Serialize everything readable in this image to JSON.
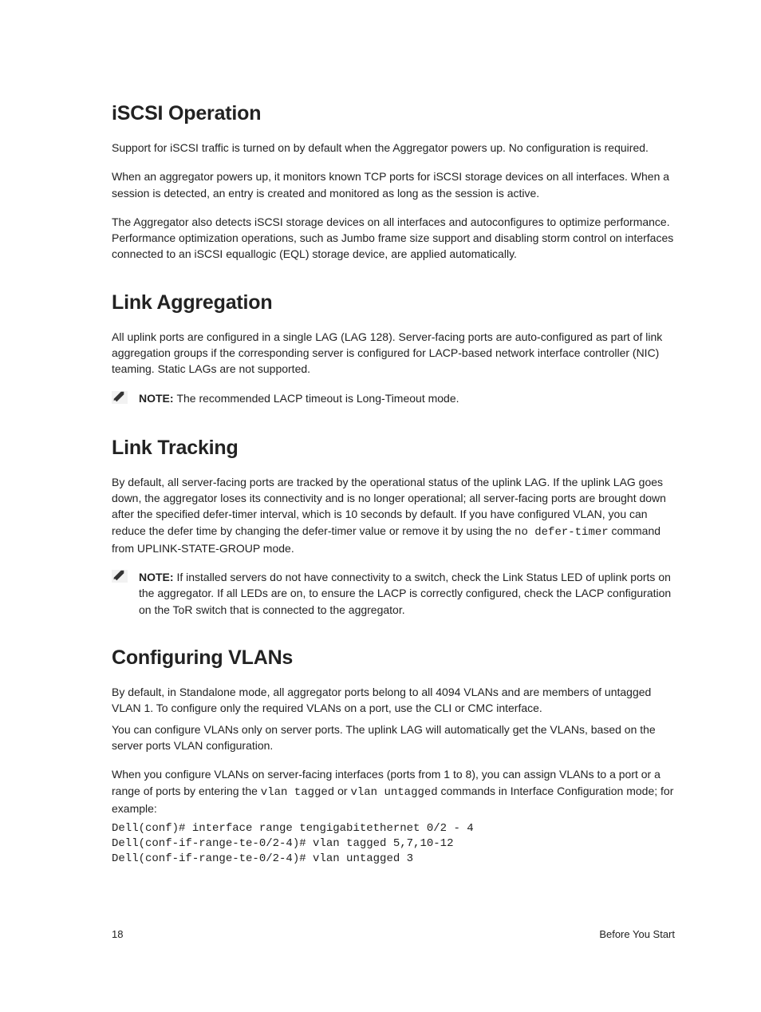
{
  "sections": {
    "iscsi": {
      "heading": "iSCSI Operation",
      "p1": "Support for iSCSI traffic is turned on by default when the Aggregator powers up. No configuration is required.",
      "p2": "When an aggregator powers up, it monitors known TCP ports for iSCSI storage devices on all interfaces. When a session is detected, an entry is created and monitored as long as the session is active.",
      "p3": "The Aggregator also detects iSCSI storage devices on all interfaces and autoconfigures to optimize performance. Performance optimization operations, such as Jumbo frame size support and disabling storm control on interfaces connected to an iSCSI equallogic (EQL) storage device, are applied automatically."
    },
    "linkagg": {
      "heading": "Link Aggregation",
      "p1": "All uplink ports are configured in a single LAG (LAG 128). Server-facing ports are auto-configured as part of link aggregation groups if the corresponding server is configured for LACP-based network interface controller (NIC) teaming. Static LAGs are not supported.",
      "note_label": "NOTE: ",
      "note_text": "The recommended LACP timeout is Long-Timeout mode."
    },
    "linktrack": {
      "heading": "Link Tracking",
      "p1_pre": "By default, all server-facing ports are tracked by the operational status of the uplink LAG. If the uplink LAG goes down, the aggregator loses its connectivity and is no longer operational; all server-facing ports are brought down after the specified defer-timer interval, which is 10 seconds by default. If you have configured VLAN, you can reduce the defer time by changing the defer-timer value or remove it by using the ",
      "p1_code": "no defer-timer",
      "p1_post": " command from UPLINK-STATE-GROUP mode.",
      "note_label": "NOTE: ",
      "note_text": "If installed servers do not have connectivity to a switch, check the Link Status LED of uplink ports on the aggregator. If all LEDs are on, to ensure the LACP is correctly configured, check the LACP configuration on the ToR switch that is connected to the aggregator."
    },
    "vlans": {
      "heading": "Configuring VLANs",
      "p1": "By default, in Standalone mode, all aggregator ports belong to all 4094 VLANs and are members of untagged VLAN 1. To configure only the required VLANs on a port, use the CLI or CMC interface.",
      "p2": "You can configure VLANs only on server ports. The uplink LAG will automatically get the VLANs, based on the server ports VLAN configuration.",
      "p3_pre": "When you configure VLANs on server-facing interfaces (ports from 1 to 8), you can assign VLANs to a port or a range of ports by entering the ",
      "p3_code1": "vlan tagged",
      "p3_mid": " or ",
      "p3_code2": "vlan untagged",
      "p3_post": " commands in Interface Configuration mode; for example:",
      "cli": "Dell(conf)# interface range tengigabitethernet 0/2 - 4\nDell(conf-if-range-te-0/2-4)# vlan tagged 5,7,10-12\nDell(conf-if-range-te-0/2-4)# vlan untagged 3"
    }
  },
  "footer": {
    "page_number": "18",
    "chapter": "Before You Start"
  }
}
